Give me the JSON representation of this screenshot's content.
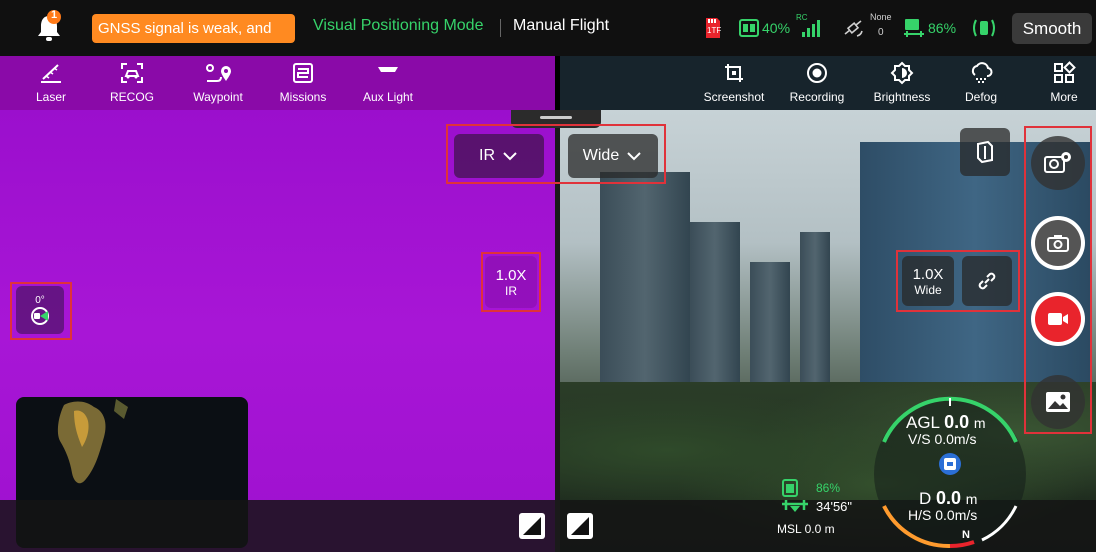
{
  "status_bar": {
    "notification_count": "1",
    "alert_text": "GNSS signal is weak, and",
    "positioning_mode": "Visual Positioning Mode",
    "flight_mode": "Manual Flight",
    "sd_label": "1TF",
    "remote_battery": "40%",
    "rc_label": "RC",
    "satellite_label": "None",
    "satellite_count": "0",
    "aircraft_battery": "86%",
    "smooth_label": "Smooth"
  },
  "toolbar_left": [
    {
      "label": "Laser",
      "icon": "laser-icon"
    },
    {
      "label": "RECOG",
      "icon": "recog-icon"
    },
    {
      "label": "Waypoint",
      "icon": "waypoint-icon"
    },
    {
      "label": "Missions",
      "icon": "missions-icon"
    },
    {
      "label": "Aux Light",
      "icon": "aux-light-icon"
    }
  ],
  "toolbar_right": [
    {
      "label": "Screenshot",
      "icon": "screenshot-icon"
    },
    {
      "label": "Recording",
      "icon": "recording-icon"
    },
    {
      "label": "Brightness",
      "icon": "brightness-icon"
    },
    {
      "label": "Defog",
      "icon": "defog-icon"
    },
    {
      "label": "More",
      "icon": "more-grid-icon"
    }
  ],
  "ir_view": {
    "lens_selector": "IR",
    "zoom": "1.0X",
    "zoom_sub": "IR",
    "gimbal_angle": "0°"
  },
  "wide_view": {
    "lens_selector": "Wide",
    "zoom": "1.0X",
    "zoom_sub": "Wide"
  },
  "telemetry": {
    "rc_battery": "86%",
    "flight_time": "34'56\"",
    "msl": "MSL 0.0 m",
    "agl_label": "AGL",
    "agl_value": "0.0",
    "agl_unit": "m",
    "vs": "V/S 0.0m/s",
    "d_label": "D",
    "d_value": "0.0",
    "d_unit": "m",
    "hs": "H/S 0.0m/s",
    "compass_n": "N"
  },
  "colors": {
    "ir_purple": "#a014d2",
    "accent_green": "#36d36a",
    "alert_orange": "#ff8a21",
    "record_red": "#e9242c",
    "highlight_red": "#e0323a"
  }
}
